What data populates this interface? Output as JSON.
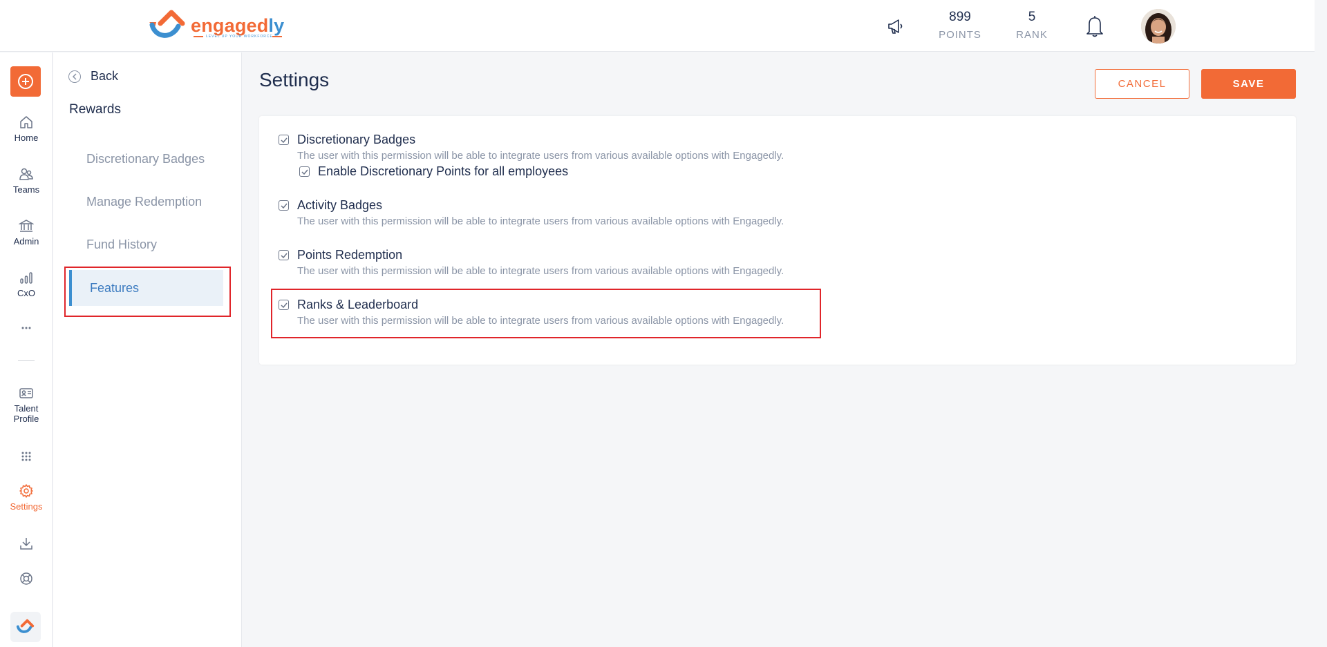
{
  "brand": {
    "name_main": "engaged",
    "name_accent": "ly",
    "tagline": "LEVEL UP YOUR WORKFORCE",
    "accent_color": "#f26a36",
    "secondary_color": "#3c8fd0"
  },
  "header": {
    "points_value": "899",
    "points_label": "POINTS",
    "rank_value": "5",
    "rank_label": "RANK",
    "icons": [
      "megaphone-icon",
      "bell-icon"
    ]
  },
  "leftnav": {
    "items": [
      {
        "label": "Home",
        "icon": "home-icon"
      },
      {
        "label": "Teams",
        "icon": "teams-icon"
      },
      {
        "label": "Admin",
        "icon": "admin-icon"
      },
      {
        "label": "CxO",
        "icon": "chart-icon"
      },
      {
        "label": "Talent",
        "label2": "Profile",
        "icon": "id-card-icon"
      },
      {
        "label": "Settings",
        "icon": "gear-icon",
        "active": true
      }
    ]
  },
  "subnav": {
    "back_label": "Back",
    "title": "Rewards",
    "items": [
      {
        "label": "Discretionary Badges"
      },
      {
        "label": "Manage Redemption"
      },
      {
        "label": "Fund History"
      },
      {
        "label": "Features",
        "active": true
      }
    ]
  },
  "main": {
    "title": "Settings",
    "cancel_label": "CANCEL",
    "save_label": "SAVE",
    "permissions": [
      {
        "title": "Discretionary Badges",
        "description": "The user with this permission will be able to integrate users from various available options with Engagedly.",
        "checked": true,
        "sub": {
          "title": "Enable Discretionary Points for all employees",
          "checked": true
        }
      },
      {
        "title": "Activity Badges",
        "description": "The user with this permission will be able to integrate users from various available options with Engagedly.",
        "checked": true
      },
      {
        "title": "Points Redemption",
        "description": "The user with this permission will be able to integrate users from various available options with Engagedly.",
        "checked": true
      },
      {
        "title": "Ranks & Leaderboard",
        "description": "The user with this permission will be able to integrate users from various available options with Engagedly.",
        "checked": true
      }
    ]
  }
}
